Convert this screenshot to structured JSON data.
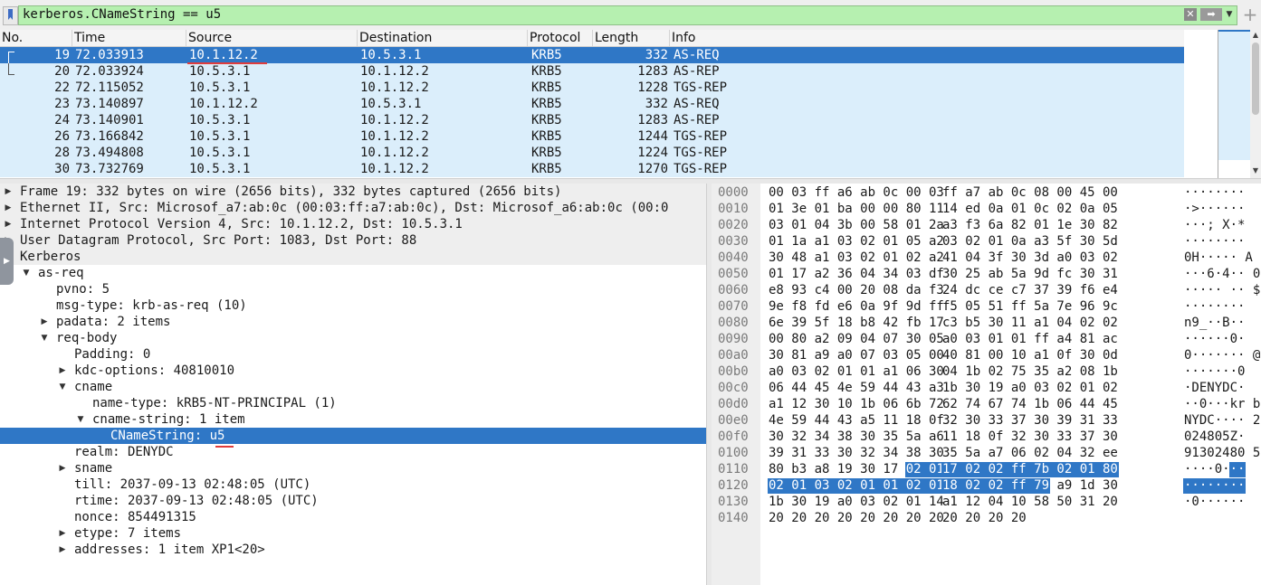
{
  "filter": {
    "expression": "kerberos.CNameString == u5"
  },
  "packet_list": {
    "columns": [
      "No.",
      "Time",
      "Source",
      "Destination",
      "Protocol",
      "Length",
      "Info"
    ],
    "rows": [
      {
        "no": "19",
        "time": "72.033913",
        "src": "10.1.12.2",
        "dst": "10.5.3.1",
        "proto": "KRB5",
        "len": "332",
        "info": "AS-REQ"
      },
      {
        "no": "20",
        "time": "72.033924",
        "src": "10.5.3.1",
        "dst": "10.1.12.2",
        "proto": "KRB5",
        "len": "1283",
        "info": "AS-REP"
      },
      {
        "no": "22",
        "time": "72.115052",
        "src": "10.5.3.1",
        "dst": "10.1.12.2",
        "proto": "KRB5",
        "len": "1228",
        "info": "TGS-REP"
      },
      {
        "no": "23",
        "time": "73.140897",
        "src": "10.1.12.2",
        "dst": "10.5.3.1",
        "proto": "KRB5",
        "len": "332",
        "info": "AS-REQ"
      },
      {
        "no": "24",
        "time": "73.140901",
        "src": "10.5.3.1",
        "dst": "10.1.12.2",
        "proto": "KRB5",
        "len": "1283",
        "info": "AS-REP"
      },
      {
        "no": "26",
        "time": "73.166842",
        "src": "10.5.3.1",
        "dst": "10.1.12.2",
        "proto": "KRB5",
        "len": "1244",
        "info": "TGS-REP"
      },
      {
        "no": "28",
        "time": "73.494808",
        "src": "10.5.3.1",
        "dst": "10.1.12.2",
        "proto": "KRB5",
        "len": "1224",
        "info": "TGS-REP"
      },
      {
        "no": "30",
        "time": "73.732769",
        "src": "10.5.3.1",
        "dst": "10.1.12.2",
        "proto": "KRB5",
        "len": "1270",
        "info": "TGS-REP"
      }
    ]
  },
  "details": [
    {
      "text": "Frame 19: 332 bytes on wire (2656 bits), 332 bytes captured (2656 bits)",
      "level": 0,
      "arrow": "collapsed"
    },
    {
      "text": "Ethernet II, Src: Microsof_a7:ab:0c (00:03:ff:a7:ab:0c), Dst: Microsof_a6:ab:0c (00:0",
      "level": 0,
      "arrow": "collapsed"
    },
    {
      "text": "Internet Protocol Version 4, Src: 10.1.12.2, Dst: 10.5.3.1",
      "level": 0,
      "arrow": "collapsed"
    },
    {
      "text": "User Datagram Protocol, Src Port: 1083, Dst Port: 88",
      "level": 0,
      "arrow": "collapsed"
    },
    {
      "text": "Kerberos",
      "level": 0,
      "arrow": "expanded"
    },
    {
      "text": "as-req",
      "level": 1,
      "arrow": "expanded"
    },
    {
      "text": "pvno: 5",
      "level": 2,
      "arrow": "none"
    },
    {
      "text": "msg-type: krb-as-req (10)",
      "level": 2,
      "arrow": "none"
    },
    {
      "text": "padata: 2 items",
      "level": 2,
      "arrow": "collapsed"
    },
    {
      "text": "req-body",
      "level": 2,
      "arrow": "expanded"
    },
    {
      "text": "Padding: 0",
      "level": 3,
      "arrow": "none"
    },
    {
      "text": "kdc-options: 40810010",
      "level": 3,
      "arrow": "collapsed"
    },
    {
      "text": "cname",
      "level": 3,
      "arrow": "expanded"
    },
    {
      "text": "name-type: kRB5-NT-PRINCIPAL (1)",
      "level": 4,
      "arrow": "none"
    },
    {
      "text": "cname-string: 1 item",
      "level": 4,
      "arrow": "expanded"
    },
    {
      "text": "CNameString: u5",
      "level": 5,
      "arrow": "none"
    },
    {
      "text": "realm: DENYDC",
      "level": 3,
      "arrow": "none"
    },
    {
      "text": "sname",
      "level": 3,
      "arrow": "collapsed"
    },
    {
      "text": "till: 2037-09-13 02:48:05 (UTC)",
      "level": 3,
      "arrow": "none"
    },
    {
      "text": "rtime: 2037-09-13 02:48:05 (UTC)",
      "level": 3,
      "arrow": "none"
    },
    {
      "text": "nonce: 854491315",
      "level": 3,
      "arrow": "none"
    },
    {
      "text": "etype: 7 items",
      "level": 3,
      "arrow": "collapsed"
    },
    {
      "text": "addresses: 1 item XP1<20>",
      "level": 3,
      "arrow": "collapsed"
    }
  ],
  "hex": [
    {
      "off": "0000",
      "a": "00 03 ff a6 ab 0c 00 03",
      "b": "ff a7 ab 0c 08 00 45 00",
      "asc": "········ "
    },
    {
      "off": "0010",
      "a": "01 3e 01 ba 00 00 80 11",
      "b": "14 ed 0a 01 0c 02 0a 05",
      "asc": "·>······ "
    },
    {
      "off": "0020",
      "a": "03 01 04 3b 00 58 01 2a",
      "b": "a3 f3 6a 82 01 1e 30 82",
      "asc": "···; X·* "
    },
    {
      "off": "0030",
      "a": "01 1a a1 03 02 01 05 a2",
      "b": "03 02 01 0a a3 5f 30 5d",
      "asc": "········ "
    },
    {
      "off": "0040",
      "a": "30 48 a1 03 02 01 02 a2",
      "b": "41 04 3f 30 3d a0 03 02",
      "asc": "0H····· A"
    },
    {
      "off": "0050",
      "a": "01 17 a2 36 04 34 03 df",
      "b": "30 25 ab 5a 9d fc 30 31",
      "asc": "···6·4·· 0"
    },
    {
      "off": "0060",
      "a": "e8 93 c4 00 20 08 da f3",
      "b": "24 dc ce c7 37 39 f6 e4",
      "asc": "····· ·· $"
    },
    {
      "off": "0070",
      "a": "9e f8 fd e6 0a 9f 9d ff",
      "b": "f5 05 51 ff 5a 7e 96 9c",
      "asc": "········ "
    },
    {
      "off": "0080",
      "a": "6e 39 5f 18 b8 42 fb 17",
      "b": "c3 b5 30 11 a1 04 02 02",
      "asc": "n9_··B·· "
    },
    {
      "off": "0090",
      "a": "00 80 a2 09 04 07 30 05",
      "b": "a0 03 01 01 ff a4 81 ac",
      "asc": "······0· "
    },
    {
      "off": "00a0",
      "a": "30 81 a9 a0 07 03 05 00",
      "b": "40 81 00 10 a1 0f 30 0d",
      "asc": "0······· @"
    },
    {
      "off": "00b0",
      "a": "a0 03 02 01 01 a1 06 30",
      "b": "04 1b 02 75 35 a2 08 1b",
      "asc": "·······0 "
    },
    {
      "off": "00c0",
      "a": "06 44 45 4e 59 44 43 a3",
      "b": "1b 30 19 a0 03 02 01 02",
      "asc": "·DENYDC· "
    },
    {
      "off": "00d0",
      "a": "a1 12 30 10 1b 06 6b 72",
      "b": "62 74 67 74 1b 06 44 45",
      "asc": "··0···kr b"
    },
    {
      "off": "00e0",
      "a": "4e 59 44 43 a5 11 18 0f",
      "b": "32 30 33 37 30 39 31 33",
      "asc": "NYDC···· 2"
    },
    {
      "off": "00f0",
      "a": "30 32 34 38 30 35 5a a6",
      "b": "11 18 0f 32 30 33 37 30",
      "asc": "024805Z· "
    },
    {
      "off": "0100",
      "a": "39 31 33 30 32 34 38 30",
      "b": "35 5a a7 06 02 04 32 ee",
      "asc": "91302480 5"
    },
    {
      "off": "0110",
      "a": "80 b3 a8 19 30 17",
      "a_hl": "02 01",
      "b_hl": "17 02 02 ff 7b 02 01 80",
      "asc": "····0·",
      "asc_hl": "··"
    },
    {
      "off": "0120",
      "a_hl": "02 01 03 02 01 01 02 01",
      "b_hl": "18 02 02 ff 79",
      "b": "a9 1d 30",
      "asc_hl": "········"
    },
    {
      "off": "0130",
      "a": "1b 30 19 a0 03 02 01 14",
      "b": "a1 12 04 10 58 50 31 20",
      "asc": "·0······ "
    },
    {
      "off": "0140",
      "a": "20 20 20 20 20 20 20 20",
      "b": "20 20 20 20",
      "asc": ""
    }
  ]
}
